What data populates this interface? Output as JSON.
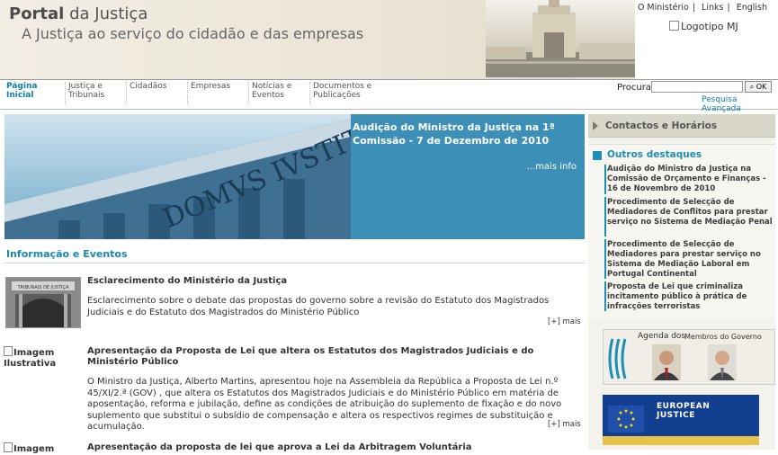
{
  "header": {
    "title_bold": "Portal",
    "title_rest": "da Justiça",
    "subtitle": "A Justiça ao serviço do cidadão e das empresas",
    "logo_alt": "Logotipo MJ",
    "top_links": [
      "O Ministério",
      "Links",
      "English"
    ],
    "separator": "|"
  },
  "nav": {
    "items": [
      {
        "label": "Página Inicial"
      },
      {
        "label": "Justiça e Tribunais"
      },
      {
        "label": "Cidadãos"
      },
      {
        "label": "Empresas"
      },
      {
        "label": "Notícias e Eventos"
      },
      {
        "label": "Documentos e Publicações"
      }
    ]
  },
  "search": {
    "label": "Procura",
    "value": "",
    "button": "OK",
    "advanced": "Pesquisa Avançada"
  },
  "banner": {
    "headline": "Audição do Ministro da Justiça na 1ª Comissão - 7 de Dezembro de 2010",
    "more": "...mais info",
    "image_text": "DOMVS IVSTITIÆ"
  },
  "section": {
    "title": "Informação e Eventos"
  },
  "news": [
    {
      "title": "Esclarecimento do Ministério da Justiça",
      "body": "Esclarecimento sobre o debate das propostas do governo sobre a revisão do Estatuto dos Magistrados Judiciais e do Estatuto dos Magistrados do Ministério Público",
      "more": "[+] mais",
      "image_sign": "TRIBUNAIS DE JUSTIÇA"
    },
    {
      "image_alt": "Imagem Ilustrativa",
      "title": "Apresentação da Proposta de Lei que altera os Estatutos dos Magistrados Judiciais e do Ministério Público",
      "body": "O Ministro da Justiça, Alberto Martins, apresentou hoje na Assembleia da República a Proposta de Lei n.º 45/XI/2.ª (GOV) , que altera os Estatutos dos Magistrados Judiciais e do Ministério Público em matéria de aposentação, reforma e jubilação, define as condições de atribuição do suplemento de fixação e do novo suplemento que substitui o subsídio de compensação e altera os respectivos regimes de substituição e acumulação.",
      "more": "[+] mais"
    },
    {
      "image_alt": "Imagem",
      "title": "Apresentação da proposta de lei que aprova a Lei da Arbitragem Voluntária"
    }
  ],
  "sidebar": {
    "contact": "Contactos e Horários",
    "outros_title": "Outros destaques",
    "outros": [
      "Audição do Ministro da Justiça na Comissão de Orçamento e Finanças - 16 de Novembro de 2010",
      "Procedimento de Selecção de Mediadores de Conflitos para prestar serviço no Sistema de Mediação Penal",
      "Procedimento de Selecção de Mediadores para prestar serviço no Sistema de Mediação Laboral em Portugal Continental",
      "Proposta de Lei que criminaliza incitamento público à prática de infracções terroristas"
    ],
    "agenda_title": "Agenda dos",
    "agenda_sub": "Membros do Governo",
    "ejustice_line1": "EUROPEAN",
    "ejustice_line2": "JUSTICE"
  }
}
